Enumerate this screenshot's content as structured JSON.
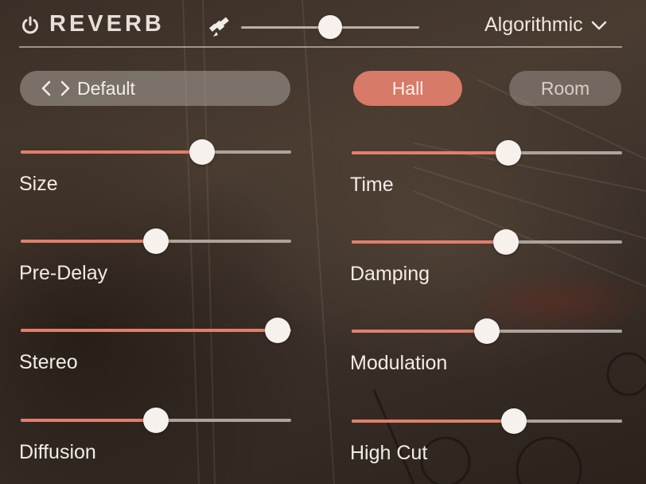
{
  "header": {
    "title": "REVERB",
    "mix_level": 0.5,
    "mode": "Algorithmic"
  },
  "preset": {
    "label": "Default"
  },
  "types": {
    "hall": "Hall",
    "room": "Room",
    "selected": "Hall"
  },
  "params": [
    {
      "id": "size",
      "label": "Size",
      "value": 0.67
    },
    {
      "id": "time",
      "label": "Time",
      "value": 0.58
    },
    {
      "id": "pre-delay",
      "label": "Pre-Delay",
      "value": 0.5
    },
    {
      "id": "damping",
      "label": "Damping",
      "value": 0.57
    },
    {
      "id": "stereo",
      "label": "Stereo",
      "value": 0.95
    },
    {
      "id": "modulation",
      "label": "Modulation",
      "value": 0.5
    },
    {
      "id": "diffusion",
      "label": "Diffusion",
      "value": 0.5
    },
    {
      "id": "high-cut",
      "label": "High Cut",
      "value": 0.6
    }
  ],
  "colors": {
    "accent": "#e07f6c",
    "pill_active": "#d77a67",
    "knob": "#f6f1ec",
    "track": "#aca39c"
  },
  "icons": {
    "power": "power-icon",
    "satellite": "satellite-icon",
    "dropdown": "chevron-down-icon",
    "prev": "chevron-left-icon",
    "next": "chevron-right-icon"
  }
}
